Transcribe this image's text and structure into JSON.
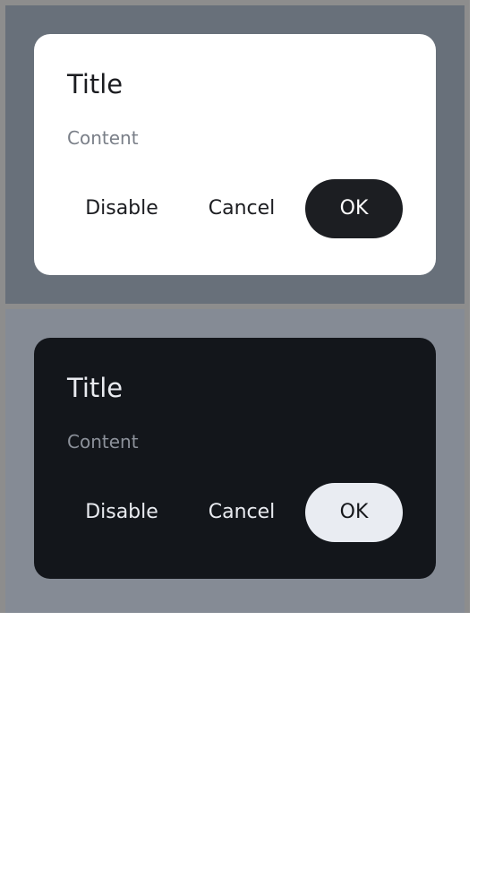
{
  "light_dialog": {
    "title": "Title",
    "content": "Content",
    "buttons": {
      "disable": "Disable",
      "cancel": "Cancel",
      "ok": "OK"
    },
    "colors": {
      "backdrop": "#68707a",
      "surface": "#ffffff",
      "primary_button": "#1c1e22"
    }
  },
  "dark_dialog": {
    "title": "Title",
    "content": "Content",
    "buttons": {
      "disable": "Disable",
      "cancel": "Cancel",
      "ok": "OK"
    },
    "colors": {
      "backdrop": "#858b95",
      "surface": "#13161b",
      "primary_button": "#e9ecf2"
    }
  }
}
